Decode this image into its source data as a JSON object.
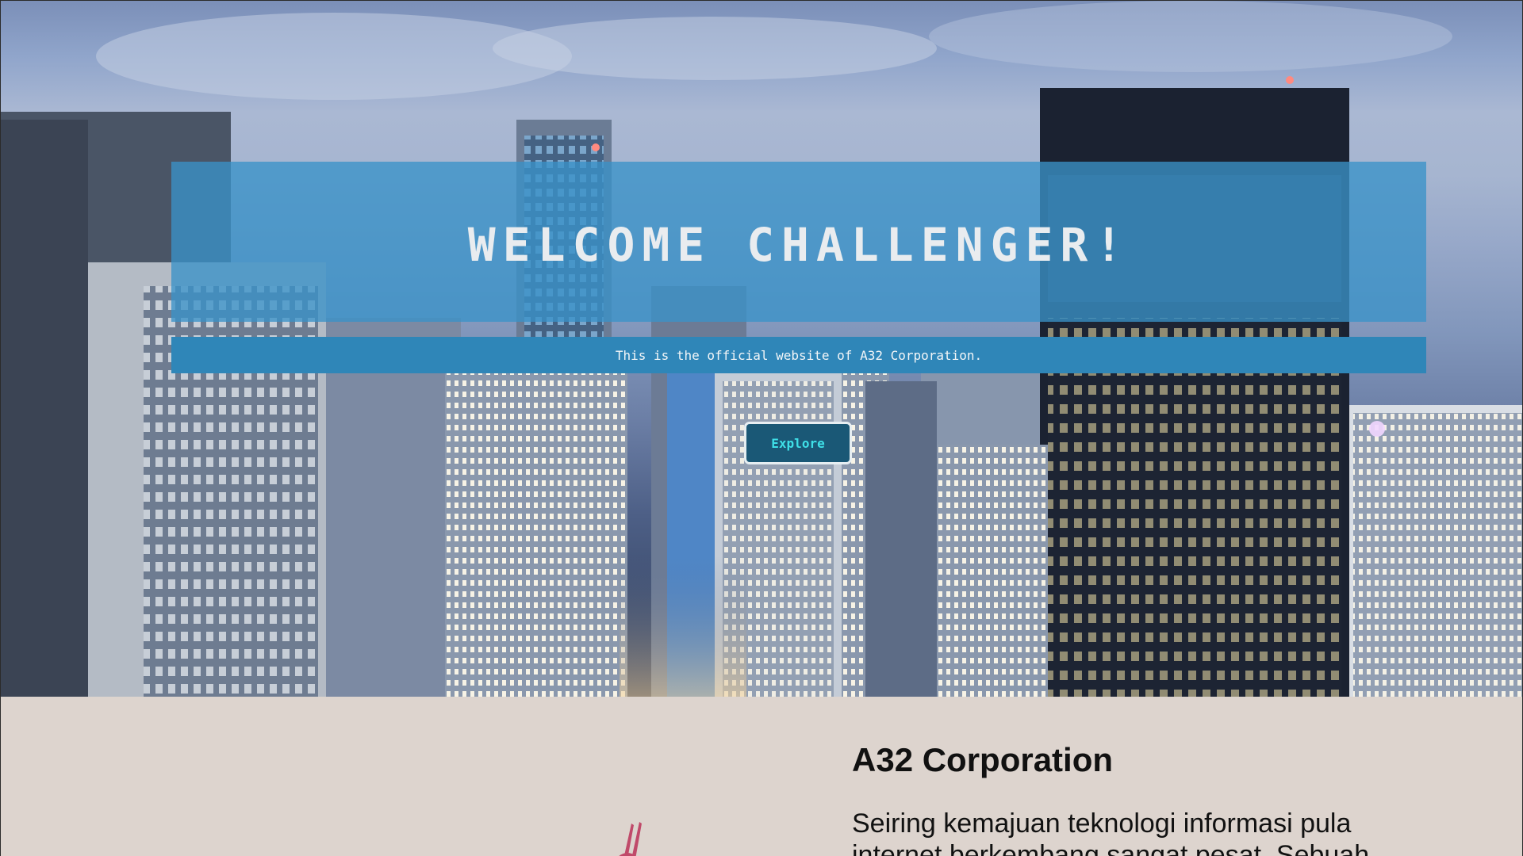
{
  "hero": {
    "title": "WELCOME CHALLENGER!",
    "tagline": "This is the official website of A32 Corporation.",
    "explore_label": "Explore"
  },
  "about": {
    "title": "A32 Corporation",
    "text": "Seiring kemajuan teknologi informasi pula internet berkembang sangat pesat. Sebuah"
  },
  "colors": {
    "banner": "#3a92c8",
    "tagline_bar": "#2f86b8",
    "button_bg": "#1a5876",
    "button_text": "#3fe0e8",
    "about_bg": "#ddd4ce"
  }
}
